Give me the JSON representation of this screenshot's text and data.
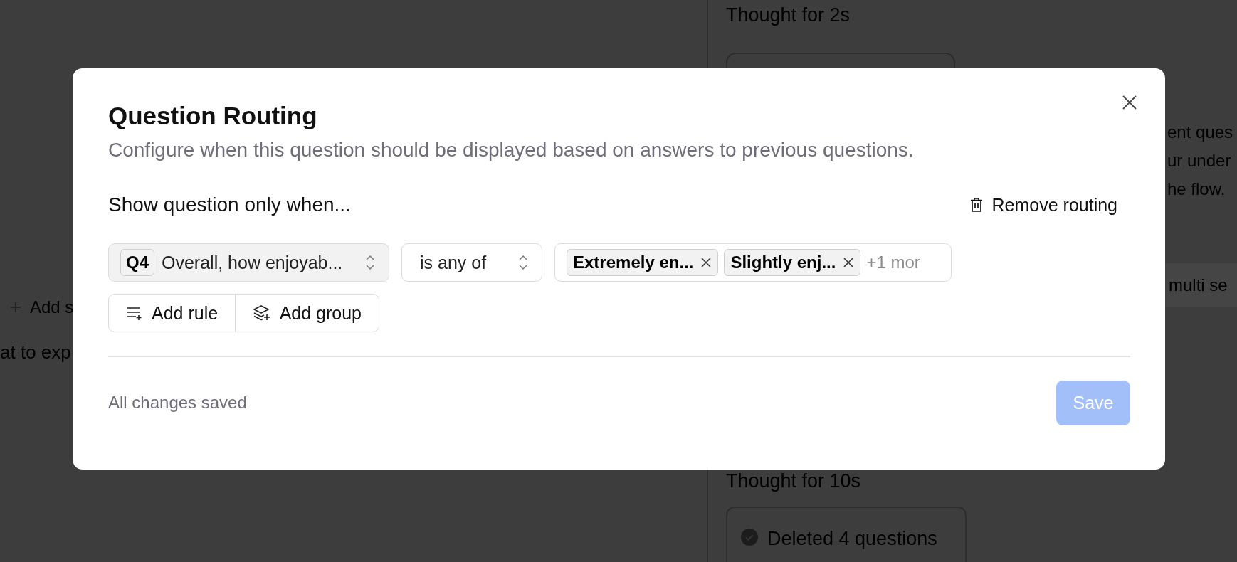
{
  "backdrop": {
    "add_link": "Add s",
    "left_text": "at to exp",
    "thought_first": "Thought for 2s",
    "message_lines": [
      "ent ques",
      "ur under",
      "he flow."
    ],
    "option_text": "multi se",
    "thought_second": "Thought for 10s",
    "status_card": "Deleted 4 questions"
  },
  "dialog": {
    "title": "Question Routing",
    "description": "Configure when this question should be displayed based on answers to previous questions.",
    "section_title": "Show question only when...",
    "remove_button": "Remove routing",
    "rule": {
      "question_tag": "Q4",
      "question": "Overall, how enjoyab...",
      "operator": "is any of",
      "values": [
        {
          "label": "Extremely en..."
        },
        {
          "label": "Slightly enj..."
        }
      ],
      "more": "+1 mor"
    },
    "add_rule": "Add rule",
    "add_group": "Add group",
    "status": "All changes saved",
    "save": {
      "label": "Save",
      "disabled": true
    }
  }
}
